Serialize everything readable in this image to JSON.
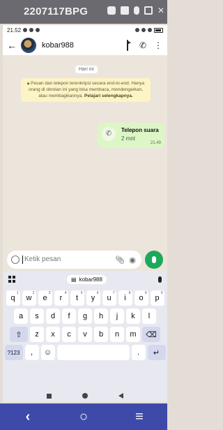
{
  "emulator": {
    "title": "2207117BPG"
  },
  "statusbar": {
    "time": "21.52"
  },
  "header": {
    "contact_name": "kobar988"
  },
  "chat": {
    "date_chip": "Hari ini",
    "encryption_notice": "Pesan dan telepon terenkripsi secara end-to-end. Hanya orang di obrolan ini yang bisa membaca, mendengarkan, atau membagikannya.",
    "encryption_link": "Pelajari selengkapnya.",
    "call_message": {
      "title": "Telepon suara",
      "duration": "2 mnt",
      "time": "21.49"
    }
  },
  "composer": {
    "placeholder": "Ketik pesan"
  },
  "keyboard": {
    "clipboard_chip": "kobar988",
    "row1": [
      {
        "k": "q",
        "n": "1"
      },
      {
        "k": "w",
        "n": "2"
      },
      {
        "k": "e",
        "n": "3"
      },
      {
        "k": "r",
        "n": "4"
      },
      {
        "k": "t",
        "n": "5"
      },
      {
        "k": "y",
        "n": "6"
      },
      {
        "k": "u",
        "n": "7"
      },
      {
        "k": "i",
        "n": "8"
      },
      {
        "k": "o",
        "n": "9"
      },
      {
        "k": "p",
        "n": "0"
      }
    ],
    "row2": [
      "a",
      "s",
      "d",
      "f",
      "g",
      "h",
      "j",
      "k",
      "l"
    ],
    "row3": [
      "z",
      "x",
      "c",
      "v",
      "b",
      "n",
      "m"
    ],
    "sym_key": "?123",
    "comma": ",",
    "period": "."
  },
  "colors": {
    "accent_green": "#1ea85b",
    "bubble_green": "#dcf6c6",
    "emulator_nav": "#3e4aa9"
  }
}
